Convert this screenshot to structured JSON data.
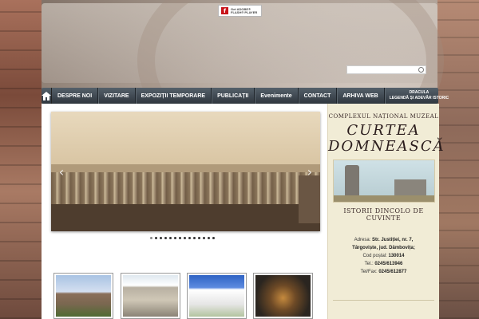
{
  "header": {
    "flash_badge": {
      "line1": "Get ADOBE®",
      "line2": "FLASH® PLAYER",
      "icon": "flash-icon"
    },
    "search": {
      "value": "",
      "placeholder": "",
      "icon": "search-icon"
    }
  },
  "nav": {
    "home_icon": "home-icon",
    "items": [
      {
        "label": "DESPRE NOI"
      },
      {
        "label": "VIZITARE"
      },
      {
        "label": "EXPOZIȚII TEMPORARE"
      },
      {
        "label": "PUBLICAȚII"
      },
      {
        "label": "Evenimente"
      },
      {
        "label": "CONTACT"
      },
      {
        "label": "ARHIVA WEB"
      }
    ],
    "last_item": {
      "line1": "DRACULA",
      "line2": "LEGENDĂ ȘI ADEVĂR ISTORIC"
    }
  },
  "slider": {
    "prev_icon": "chevron-left-icon",
    "next_icon": "chevron-right-icon",
    "slide_count": 14,
    "active_index": 0
  },
  "sidebar": {
    "logo_top": "COMPLEXUL NAȚIONAL MUZEAL",
    "logo_main": "CURTEA DOMNEASCĂ",
    "logo_bottom": "ISTORII DINCOLO DE CUVINTE",
    "address_label": "Adresa:",
    "address_value": "Str. Justiției, nr. 7,",
    "address_city": "Târgoviște, jud. Dâmbovița;",
    "postal_label": "Cod poștal:",
    "postal_value": "130014",
    "tel_label": "Tel.:",
    "tel_value": "0245/613946",
    "telfax_label": "Tel/Fax:",
    "telfax_value": "0245/612877"
  },
  "colors": {
    "nav_bg": "#3a434b",
    "sidebar_bg": "#f1ecd6",
    "flash_red": "#c8141a"
  }
}
